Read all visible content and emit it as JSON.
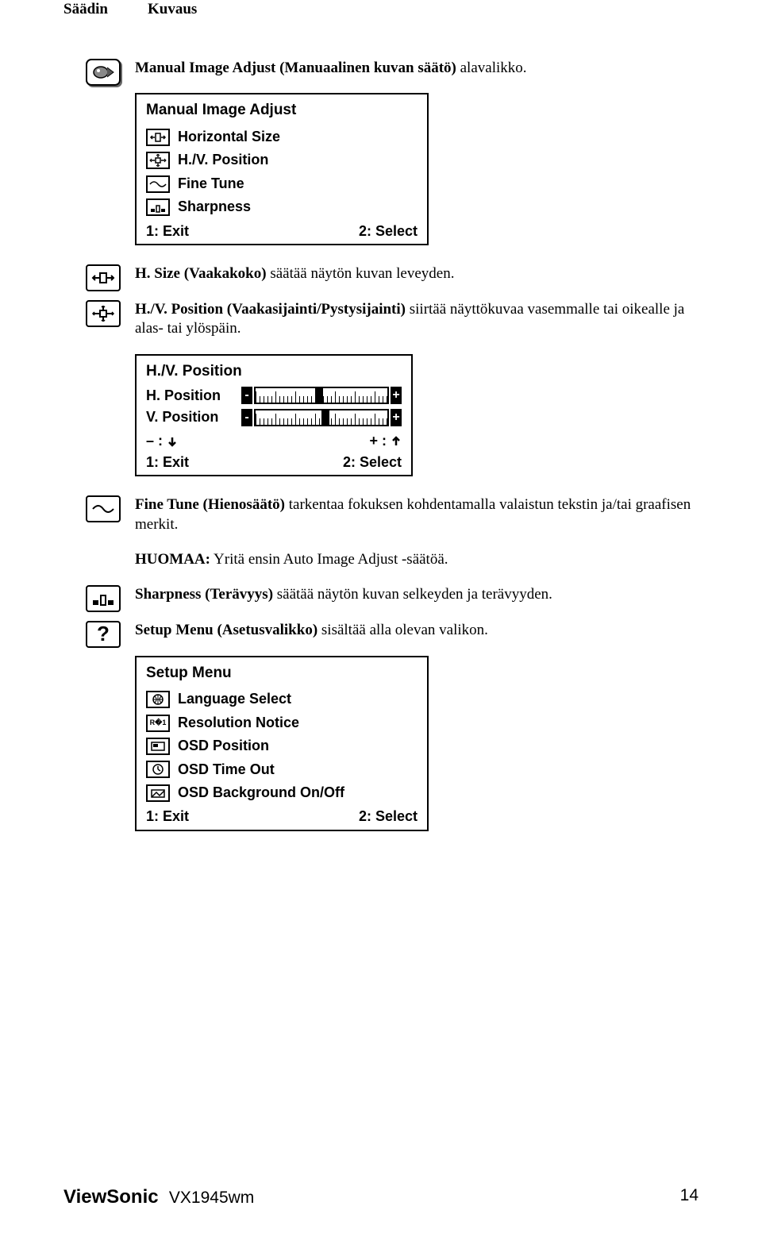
{
  "header": {
    "col1": "Säädin",
    "col2": "Kuvaus"
  },
  "sections": {
    "manual_image_adjust": {
      "intro_bold": "Manual Image Adjust (Manuaalinen kuvan säätö)",
      "intro_rest": " alavalikko.",
      "osd": {
        "title": "Manual Image Adjust",
        "items": [
          "Horizontal Size",
          "H./V. Position",
          "Fine Tune",
          "Sharpness"
        ],
        "exit": "1: Exit",
        "select": "2: Select"
      }
    },
    "h_size": {
      "bold": "H. Size (Vaakakoko)",
      "rest": " säätää näytön kuvan leveyden."
    },
    "hv_position": {
      "bold": "H./V. Position (Vaakasijainti/Pystysijainti)",
      "rest": " siirtää näyttökuvaa vasemmalle tai oikealle ja alas- tai ylöspäin.",
      "osd": {
        "title": "H./V. Position",
        "rows": [
          "H. Position",
          "V. Position"
        ],
        "minus_legend": "– :",
        "plus_legend": "+ :",
        "exit": "1: Exit",
        "select": "2: Select"
      }
    },
    "fine_tune": {
      "bold": "Fine Tune (Hienosäätö)",
      "rest": " tarkentaa fokuksen kohdentamalla valaistun tekstin ja/tai graafisen merkit.",
      "note_bold": "HUOMAA:",
      "note_rest": " Yritä ensin Auto Image Adjust -säätöä."
    },
    "sharpness": {
      "bold": "Sharpness (Terävyys)",
      "rest": " säätää näytön kuvan selkeyden ja terävyyden."
    },
    "setup_menu": {
      "bold": "Setup Menu (Asetusvalikko)",
      "rest": " sisältää alla olevan valikon.",
      "osd": {
        "title": "Setup Menu",
        "items": [
          "Language Select",
          "Resolution Notice",
          "OSD Position",
          "OSD Time Out",
          "OSD Background On/Off"
        ],
        "exit": "1: Exit",
        "select": "2: Select"
      }
    }
  },
  "footer": {
    "brand": "ViewSonic",
    "model": "VX1945wm",
    "page": "14"
  }
}
